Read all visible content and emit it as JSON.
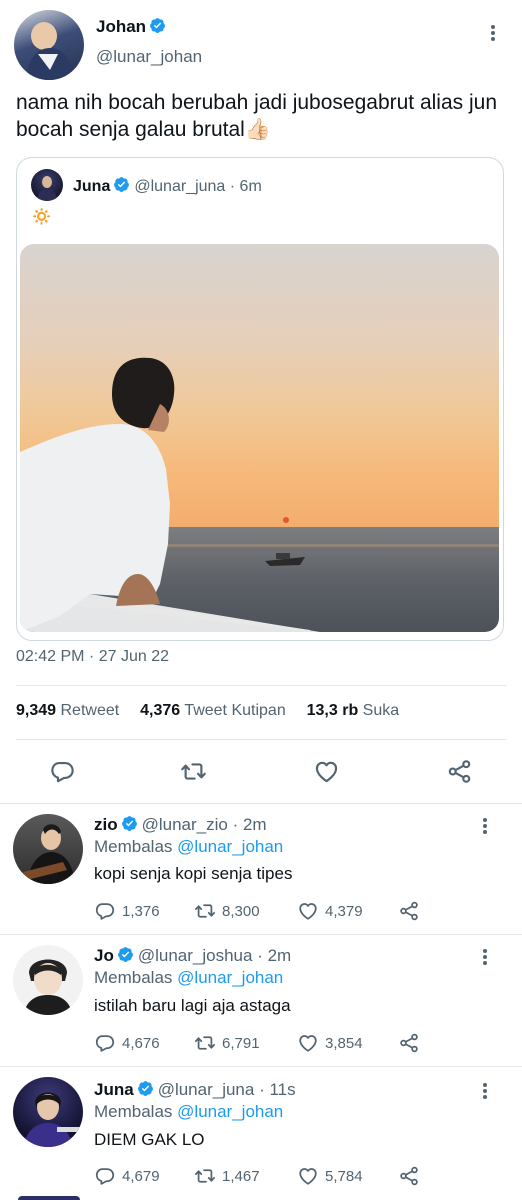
{
  "tweet": {
    "author_name": "Johan",
    "author_handle": "@lunar_johan",
    "text": "nama nih bocah berubah jadi jubosegabrut alias jun bocah senja galau brutal",
    "emoji": "👍🏻",
    "timestamp": "02:42 PM · 27 Jun 22",
    "stats": {
      "retweets_value": "9,349",
      "retweets_label": "Retweet",
      "quotes_value": "4,376",
      "quotes_label": "Tweet Kutipan",
      "likes_value": "13,3 rb",
      "likes_label": "Suka"
    }
  },
  "quoted": {
    "author_name": "Juna",
    "author_handle": "@lunar_juna",
    "time": "· 6m",
    "text": "🔅"
  },
  "replies": [
    {
      "name": "zio",
      "handle": "@lunar_zio",
      "time": "· 2m",
      "reply_prefix": "Membalas",
      "reply_to": "@lunar_johan",
      "text": "kopi senja kopi senja tipes",
      "replies_count": "1,376",
      "retweets_count": "8,300",
      "likes_count": "4,379"
    },
    {
      "name": "Jo",
      "handle": "@lunar_joshua",
      "time": "· 2m",
      "reply_prefix": "Membalas",
      "reply_to": "@lunar_johan",
      "text": "istilah baru lagi aja astaga",
      "replies_count": "4,676",
      "retweets_count": "6,791",
      "likes_count": "3,854"
    },
    {
      "name": "Juna",
      "handle": "@lunar_juna",
      "time": "· 11s",
      "reply_prefix": "Membalas",
      "reply_to": "@lunar_johan",
      "text": "DIEM GAK LO",
      "replies_count": "4,679",
      "retweets_count": "1,467",
      "likes_count": "5,784"
    }
  ],
  "colors": {
    "accent": "#1d9bf0",
    "text": "#0f1419",
    "muted": "#536471",
    "divider": "#e1e6ea"
  }
}
